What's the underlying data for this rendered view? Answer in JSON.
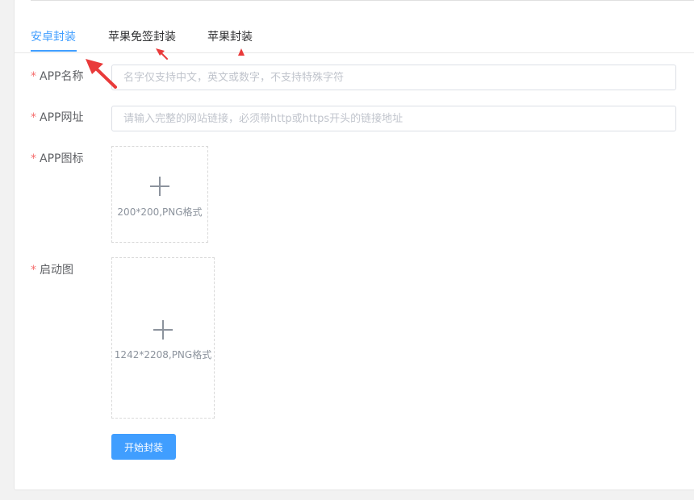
{
  "tabs": [
    {
      "label": "安卓封装",
      "active": true
    },
    {
      "label": "苹果免签封装",
      "active": false
    },
    {
      "label": "苹果封装",
      "active": false
    }
  ],
  "form": {
    "required_mark": "*",
    "app_name": {
      "label": "APP名称",
      "placeholder": "名字仅支持中文，英文或数字，不支持特殊字符",
      "value": ""
    },
    "app_url": {
      "label": "APP网址",
      "placeholder": "请输入完整的网站链接，必须带http或https开头的链接地址",
      "value": ""
    },
    "app_icon": {
      "label": "APP图标",
      "hint": "200*200,PNG格式"
    },
    "splash": {
      "label": "启动图",
      "hint": "1242*2208,PNG格式"
    },
    "submit_label": "开始封装"
  },
  "colors": {
    "accent": "#409eff",
    "required": "#f56c6c",
    "annotation_arrow": "#e93a3a"
  },
  "icons": {
    "upload": "plus-icon",
    "annotation": "red-arrow-icon"
  }
}
